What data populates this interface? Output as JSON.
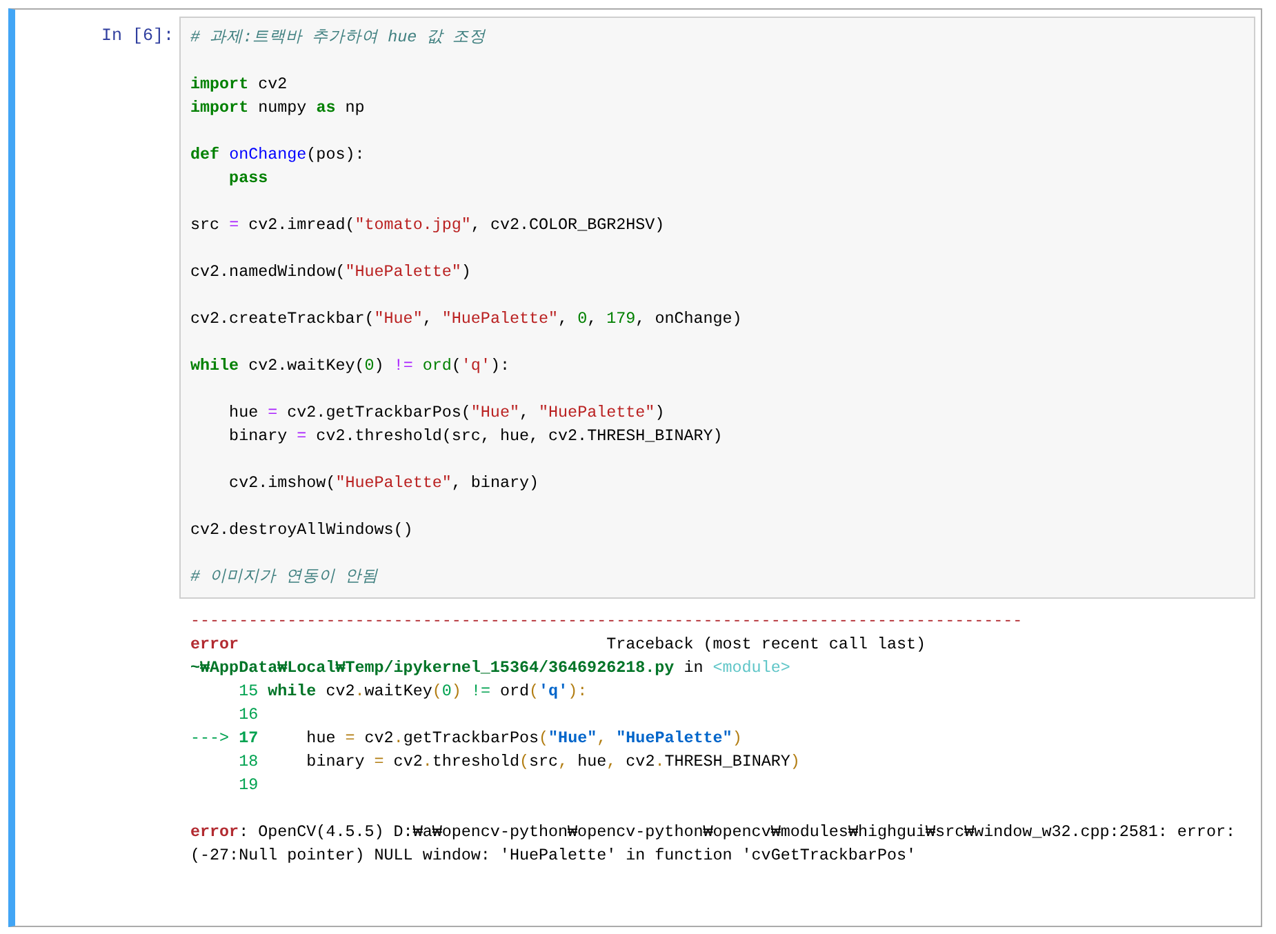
{
  "cell": {
    "prompt": "In [6]:",
    "selected": true,
    "input": {
      "lines": [
        {
          "kind": "code",
          "tokens": [
            {
              "kind": "cm",
              "t": "# 과제:트랙바 추가하여 hue 값 조정"
            }
          ]
        },
        {
          "kind": "blank"
        },
        {
          "kind": "code",
          "tokens": [
            {
              "kind": "kw",
              "t": "import"
            },
            {
              "kind": "plain",
              "t": " cv2"
            }
          ]
        },
        {
          "kind": "code",
          "tokens": [
            {
              "kind": "kw",
              "t": "import"
            },
            {
              "kind": "plain",
              "t": " numpy "
            },
            {
              "kind": "kw",
              "t": "as"
            },
            {
              "kind": "plain",
              "t": " np"
            }
          ]
        },
        {
          "kind": "blank"
        },
        {
          "kind": "code",
          "tokens": [
            {
              "kind": "kw",
              "t": "def "
            },
            {
              "kind": "def",
              "t": "onChange"
            },
            {
              "kind": "plain",
              "t": "(pos):"
            }
          ]
        },
        {
          "kind": "code",
          "tokens": [
            {
              "kind": "kw",
              "t": "    pass"
            }
          ]
        },
        {
          "kind": "blank"
        },
        {
          "kind": "code",
          "tokens": [
            {
              "kind": "plain",
              "t": "src "
            },
            {
              "kind": "op",
              "t": "="
            },
            {
              "kind": "plain",
              "t": " cv2.imread("
            },
            {
              "kind": "str",
              "t": "\"tomato.jpg\""
            },
            {
              "kind": "plain",
              "t": ", cv2.COLOR_BGR2HSV)"
            }
          ]
        },
        {
          "kind": "blank"
        },
        {
          "kind": "code",
          "tokens": [
            {
              "kind": "plain",
              "t": "cv2.namedWindow("
            },
            {
              "kind": "str",
              "t": "\"HuePalette\""
            },
            {
              "kind": "plain",
              "t": ")"
            }
          ]
        },
        {
          "kind": "blank"
        },
        {
          "kind": "code",
          "tokens": [
            {
              "kind": "plain",
              "t": "cv2.createTrackbar("
            },
            {
              "kind": "str",
              "t": "\"Hue\""
            },
            {
              "kind": "plain",
              "t": ", "
            },
            {
              "kind": "str",
              "t": "\"HuePalette\""
            },
            {
              "kind": "plain",
              "t": ", "
            },
            {
              "kind": "num",
              "t": "0"
            },
            {
              "kind": "plain",
              "t": ", "
            },
            {
              "kind": "num",
              "t": "179"
            },
            {
              "kind": "plain",
              "t": ", onChange)"
            }
          ]
        },
        {
          "kind": "blank"
        },
        {
          "kind": "code",
          "tokens": [
            {
              "kind": "kw",
              "t": "while"
            },
            {
              "kind": "plain",
              "t": " cv2.waitKey("
            },
            {
              "kind": "num",
              "t": "0"
            },
            {
              "kind": "plain",
              "t": ") "
            },
            {
              "kind": "op",
              "t": "!= "
            },
            {
              "kind": "builtin",
              "t": "ord"
            },
            {
              "kind": "plain",
              "t": "("
            },
            {
              "kind": "str",
              "t": "'q'"
            },
            {
              "kind": "plain",
              "t": "):"
            }
          ]
        },
        {
          "kind": "blank"
        },
        {
          "kind": "code",
          "tokens": [
            {
              "kind": "plain",
              "t": "    hue "
            },
            {
              "kind": "op",
              "t": "="
            },
            {
              "kind": "plain",
              "t": " cv2.getTrackbarPos("
            },
            {
              "kind": "str",
              "t": "\"Hue\""
            },
            {
              "kind": "plain",
              "t": ", "
            },
            {
              "kind": "str",
              "t": "\"HuePalette\""
            },
            {
              "kind": "plain",
              "t": ")"
            }
          ]
        },
        {
          "kind": "code",
          "tokens": [
            {
              "kind": "plain",
              "t": "    binary "
            },
            {
              "kind": "op",
              "t": "="
            },
            {
              "kind": "plain",
              "t": " cv2.threshold(src, hue, cv2.THRESH_BINARY)"
            }
          ]
        },
        {
          "kind": "blank"
        },
        {
          "kind": "code",
          "tokens": [
            {
              "kind": "plain",
              "t": "    cv2.imshow("
            },
            {
              "kind": "str",
              "t": "\"HuePalette\""
            },
            {
              "kind": "plain",
              "t": ", binary)"
            }
          ]
        },
        {
          "kind": "blank"
        },
        {
          "kind": "code",
          "tokens": [
            {
              "kind": "plain",
              "t": "cv2.destroyAllWindows()"
            }
          ]
        },
        {
          "kind": "blank"
        },
        {
          "kind": "code",
          "tokens": [
            {
              "kind": "cm",
              "t": "# 이미지가 연동이 안됨"
            }
          ]
        }
      ]
    },
    "output": {
      "lines": [
        {
          "kind": "code",
          "tokens": [
            {
              "kind": "sep",
              "t": "--------------------------------------------------------------------------------------"
            }
          ]
        },
        {
          "kind": "code",
          "tokens": [
            {
              "kind": "err",
              "t": "error"
            },
            {
              "kind": "plain",
              "t": "                                      Traceback (most recent call last)"
            }
          ]
        },
        {
          "kind": "code",
          "tokens": [
            {
              "kind": "path",
              "t": "~₩AppData₩Local₩Temp/ipykernel_15364/3646926218.py"
            },
            {
              "kind": "plain",
              "t": " in "
            },
            {
              "kind": "mod",
              "t": "<module>"
            }
          ]
        },
        {
          "kind": "code",
          "tokens": [
            {
              "kind": "lnum",
              "t": "     15 "
            },
            {
              "kind": "okw",
              "t": "while"
            },
            {
              "kind": "plain",
              "t": " cv2"
            },
            {
              "kind": "paren",
              "t": "."
            },
            {
              "kind": "plain",
              "t": "waitKey"
            },
            {
              "kind": "paren",
              "t": "("
            },
            {
              "kind": "lnum",
              "t": "0"
            },
            {
              "kind": "paren",
              "t": ") "
            },
            {
              "kind": "lnum",
              "t": "!="
            },
            {
              "kind": "plain",
              "t": " ord"
            },
            {
              "kind": "paren",
              "t": "("
            },
            {
              "kind": "ostr",
              "t": "'q'"
            },
            {
              "kind": "paren",
              "t": "):"
            }
          ]
        },
        {
          "kind": "code",
          "tokens": [
            {
              "kind": "lnum",
              "t": "     16"
            }
          ]
        },
        {
          "kind": "code",
          "tokens": [
            {
              "kind": "lnum",
              "t": "---> "
            },
            {
              "kind": "lnumb",
              "t": "17"
            },
            {
              "kind": "plain",
              "t": "     hue "
            },
            {
              "kind": "paren",
              "t": "="
            },
            {
              "kind": "plain",
              "t": " cv2"
            },
            {
              "kind": "paren",
              "t": "."
            },
            {
              "kind": "plain",
              "t": "getTrackbarPos"
            },
            {
              "kind": "paren",
              "t": "("
            },
            {
              "kind": "ostr",
              "t": "\"Hue\""
            },
            {
              "kind": "paren",
              "t": ", "
            },
            {
              "kind": "ostr",
              "t": "\"HuePalette\""
            },
            {
              "kind": "paren",
              "t": ")"
            }
          ]
        },
        {
          "kind": "code",
          "tokens": [
            {
              "kind": "lnum",
              "t": "     18"
            },
            {
              "kind": "plain",
              "t": "     binary "
            },
            {
              "kind": "paren",
              "t": "="
            },
            {
              "kind": "plain",
              "t": " cv2"
            },
            {
              "kind": "paren",
              "t": "."
            },
            {
              "kind": "plain",
              "t": "threshold"
            },
            {
              "kind": "paren",
              "t": "("
            },
            {
              "kind": "plain",
              "t": "src"
            },
            {
              "kind": "paren",
              "t": ","
            },
            {
              "kind": "plain",
              "t": " hue"
            },
            {
              "kind": "paren",
              "t": ","
            },
            {
              "kind": "plain",
              "t": " cv2"
            },
            {
              "kind": "paren",
              "t": "."
            },
            {
              "kind": "plain",
              "t": "THRESH_BINARY"
            },
            {
              "kind": "paren",
              "t": ")"
            }
          ]
        },
        {
          "kind": "code",
          "tokens": [
            {
              "kind": "lnum",
              "t": "     19"
            }
          ]
        },
        {
          "kind": "blank"
        },
        {
          "kind": "code",
          "tokens": [
            {
              "kind": "err",
              "t": "error"
            },
            {
              "kind": "plain",
              "t": ": OpenCV(4.5.5) D:₩a₩opencv-python₩opencv-python₩opencv₩modules₩highgui₩src₩window_w32.cpp:2581: error:"
            }
          ]
        },
        {
          "kind": "code",
          "tokens": [
            {
              "kind": "plain",
              "t": "(-27:Null pointer) NULL window: 'HuePalette' in function 'cvGetTrackbarPos'"
            }
          ]
        }
      ]
    }
  }
}
